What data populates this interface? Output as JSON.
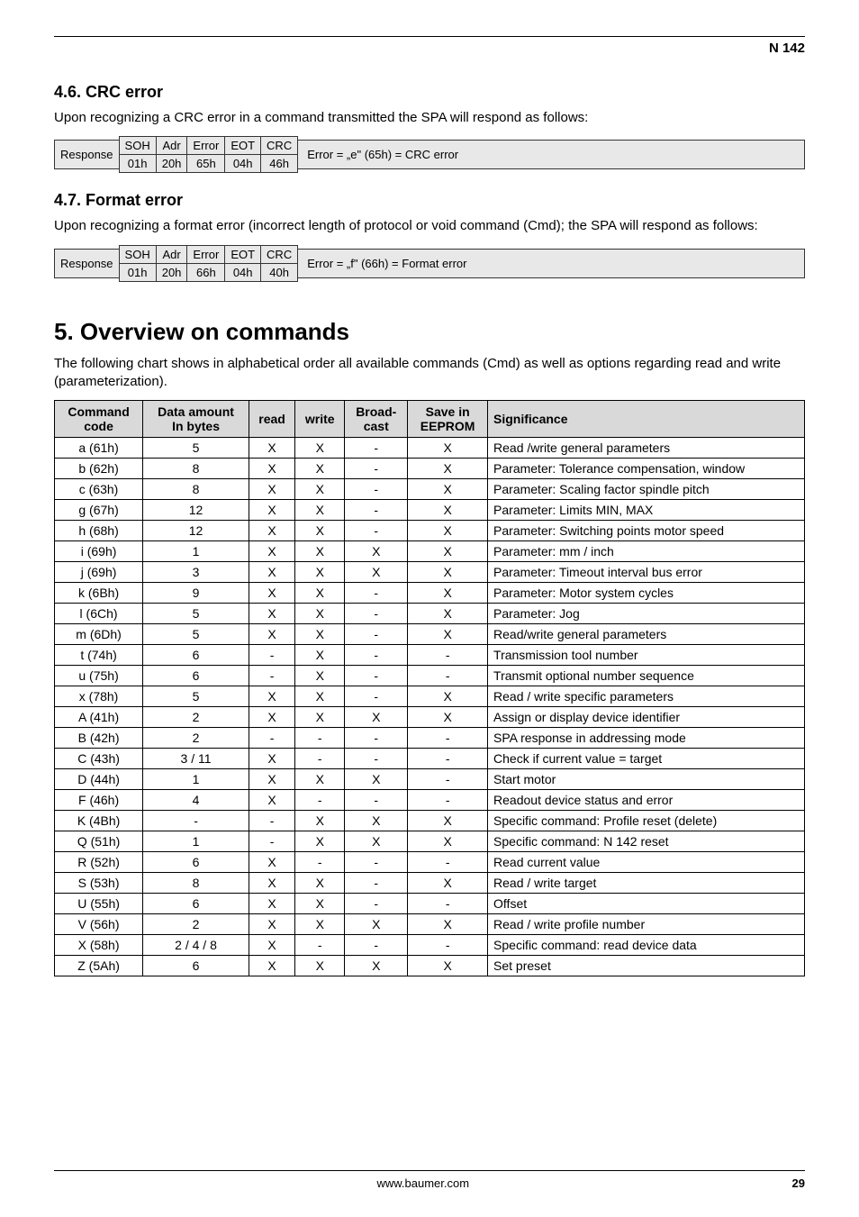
{
  "header": {
    "doc_id": "N 142"
  },
  "s46": {
    "title": "4.6.   CRC error",
    "intro": "Upon recognizing a CRC error in a command transmitted the SPA will respond as follows:",
    "row_label": "Response",
    "headers": [
      "SOH",
      "Adr",
      "Error",
      "EOT",
      "CRC"
    ],
    "values": [
      "01h",
      "20h",
      "65h",
      "04h",
      "46h"
    ],
    "note": "Error = „e\" (65h)  = CRC error"
  },
  "s47": {
    "title": "4.7.   Format error",
    "intro": "Upon recognizing a format error (incorrect length of protocol or void command (Cmd); the SPA will respond as follows:",
    "row_label": "Response",
    "headers": [
      "SOH",
      "Adr",
      "Error",
      "EOT",
      "CRC"
    ],
    "values": [
      "01h",
      "20h",
      "66h",
      "04h",
      "40h"
    ],
    "note": "Error = „f\" (66h)  = Format error"
  },
  "ch5": {
    "title": "5. Overview on commands",
    "intro": "The following chart shows in alphabetical order all available commands (Cmd) as well as options regarding read and write (parameterization).",
    "headers": {
      "col1a": "Command",
      "col1b": "code",
      "col2a": "Data amount",
      "col2b": "In bytes",
      "col3": "read",
      "col4": "write",
      "col5a": "Broad-",
      "col5b": "cast",
      "col6a": "Save in",
      "col6b": "EEPROM",
      "col7": "Significance"
    },
    "rows": [
      {
        "cmd": "a  (61h)",
        "da": "5",
        "r": "X",
        "w": "X",
        "b": "-",
        "e": "X",
        "sig": "Read /write general parameters"
      },
      {
        "cmd": "b  (62h)",
        "da": "8",
        "r": "X",
        "w": "X",
        "b": "-",
        "e": "X",
        "sig": "Parameter: Tolerance compensation, window"
      },
      {
        "cmd": "c  (63h)",
        "da": "8",
        "r": "X",
        "w": "X",
        "b": "-",
        "e": "X",
        "sig": "Parameter: Scaling factor spindle pitch"
      },
      {
        "cmd": "g  (67h)",
        "da": "12",
        "r": "X",
        "w": "X",
        "b": "-",
        "e": "X",
        "sig": "Parameter: Limits MIN, MAX"
      },
      {
        "cmd": "h  (68h)",
        "da": "12",
        "r": "X",
        "w": "X",
        "b": "-",
        "e": "X",
        "sig": "Parameter: Switching points motor speed"
      },
      {
        "cmd": "i  (69h)",
        "da": "1",
        "r": "X",
        "w": "X",
        "b": "X",
        "e": "X",
        "sig": "Parameter: mm / inch"
      },
      {
        "cmd": "j  (69h)",
        "da": "3",
        "r": "X",
        "w": "X",
        "b": "X",
        "e": "X",
        "sig": "Parameter: Timeout interval bus error"
      },
      {
        "cmd": "k  (6Bh)",
        "da": "9",
        "r": "X",
        "w": "X",
        "b": "-",
        "e": "X",
        "sig": "Parameter: Motor system cycles"
      },
      {
        "cmd": "l  (6Ch)",
        "da": "5",
        "r": "X",
        "w": "X",
        "b": "-",
        "e": "X",
        "sig": "Parameter: Jog"
      },
      {
        "cmd": "m  (6Dh)",
        "da": "5",
        "r": "X",
        "w": "X",
        "b": "-",
        "e": "X",
        "sig": "Read/write general parameters"
      },
      {
        "cmd": "t  (74h)",
        "da": "6",
        "r": "-",
        "w": "X",
        "b": "-",
        "e": "-",
        "sig": "Transmission tool number"
      },
      {
        "cmd": "u  (75h)",
        "da": "6",
        "r": "-",
        "w": "X",
        "b": "-",
        "e": "-",
        "sig": "Transmit optional number sequence"
      },
      {
        "cmd": "x  (78h)",
        "da": "5",
        "r": "X",
        "w": "X",
        "b": "-",
        "e": "X",
        "sig": "Read / write specific parameters"
      },
      {
        "cmd": "A  (41h)",
        "da": "2",
        "r": "X",
        "w": "X",
        "b": "X",
        "e": "X",
        "sig": "Assign or display device identifier"
      },
      {
        "cmd": "B  (42h)",
        "da": "2",
        "r": "-",
        "w": "-",
        "b": "-",
        "e": "-",
        "sig": "SPA response in addressing mode"
      },
      {
        "cmd": "C  (43h)",
        "da": "3 / 11",
        "r": "X",
        "w": "-",
        "b": "-",
        "e": "-",
        "sig": "Check if current value = target"
      },
      {
        "cmd": "D  (44h)",
        "da": "1",
        "r": "X",
        "w": "X",
        "b": "X",
        "e": "-",
        "sig": "Start motor"
      },
      {
        "cmd": "F  (46h)",
        "da": "4",
        "r": "X",
        "w": "-",
        "b": "-",
        "e": "-",
        "sig": "Readout device status and error"
      },
      {
        "cmd": "K  (4Bh)",
        "da": "-",
        "r": "-",
        "w": "X",
        "b": "X",
        "e": "X",
        "sig": "Specific command: Profile reset (delete)"
      },
      {
        "cmd": "Q  (51h)",
        "da": "1",
        "r": "-",
        "w": "X",
        "b": "X",
        "e": "X",
        "sig": "Specific command: N 142 reset"
      },
      {
        "cmd": "R  (52h)",
        "da": "6",
        "r": "X",
        "w": "-",
        "b": "-",
        "e": "-",
        "sig": "Read current value"
      },
      {
        "cmd": "S  (53h)",
        "da": "8",
        "r": "X",
        "w": "X",
        "b": "-",
        "e": "X",
        "sig": "Read / write target"
      },
      {
        "cmd": "U  (55h)",
        "da": "6",
        "r": "X",
        "w": "X",
        "b": "-",
        "e": "-",
        "sig": "Offset"
      },
      {
        "cmd": "V  (56h)",
        "da": "2",
        "r": "X",
        "w": "X",
        "b": "X",
        "e": "X",
        "sig": "Read / write profile number"
      },
      {
        "cmd": "X  (58h)",
        "da": "2 / 4 / 8",
        "r": "X",
        "w": "-",
        "b": "-",
        "e": "-",
        "sig": "Specific command: read device data"
      },
      {
        "cmd": "Z  (5Ah)",
        "da": "6",
        "r": "X",
        "w": "X",
        "b": "X",
        "e": "X",
        "sig": "Set preset"
      }
    ]
  },
  "footer": {
    "left": "",
    "center": "www.baumer.com",
    "right": "29"
  }
}
